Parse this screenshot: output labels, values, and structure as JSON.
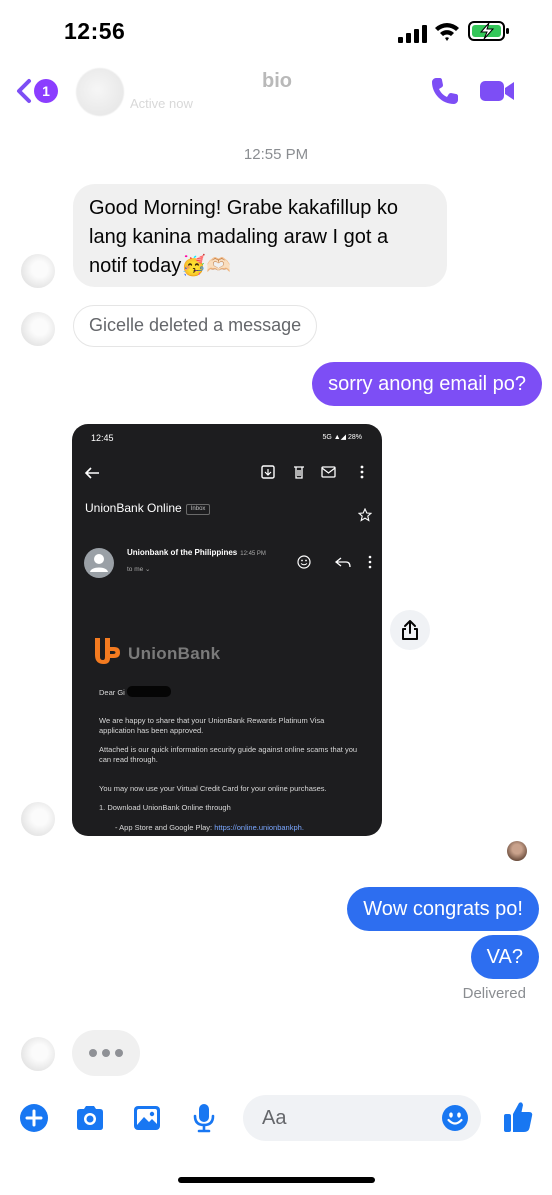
{
  "status_bar": {
    "time": "12:56"
  },
  "header": {
    "unread_count": "1",
    "contact_name": "bio",
    "active_status": "Active now"
  },
  "thread": {
    "timestamp": "12:55 PM",
    "messages": [
      {
        "direction": "incoming",
        "text": "Good Morning! Grabe kakafillup ko lang kanina madaling araw I got a notif today🥳🫶🏻"
      },
      {
        "direction": "incoming",
        "text": "Gicelle deleted a message"
      },
      {
        "direction": "outgoing",
        "text": "sorry anong email po?"
      },
      {
        "direction": "outgoing",
        "text": "Wow congrats po!"
      },
      {
        "direction": "outgoing",
        "text": "VA?"
      }
    ],
    "delivered_label": "Delivered"
  },
  "email_screenshot": {
    "phone_time": "12:45",
    "phone_status": "5G ▲◢ 28%",
    "app_title": "UnionBank Online",
    "inbox_label": "Inbox",
    "sender": "Unionbank of the Philippines",
    "sent_time": "12:45 PM",
    "to_me": "to me ⌄",
    "brand": "UnionBank",
    "greeting": "Dear Gi",
    "paragraphs": [
      "We are happy to share that your UnionBank Rewards Platinum Visa application has been approved.",
      "Attached is our quick information security guide against online scams that you can read through.",
      "You may now use your Virtual Credit Card for your online purchases.",
      "1. Download UnionBank Online through"
    ],
    "store_line": "- App Store and Google Play:",
    "store_link": "https://online.unionbankph."
  },
  "composer": {
    "placeholder": "Aa"
  },
  "colors": {
    "messenger_purple": "#7d4ef5",
    "messenger_blue": "#2d6ef0",
    "icon_blue": "#1877f2",
    "unionbank_orange": "#f47b20"
  }
}
